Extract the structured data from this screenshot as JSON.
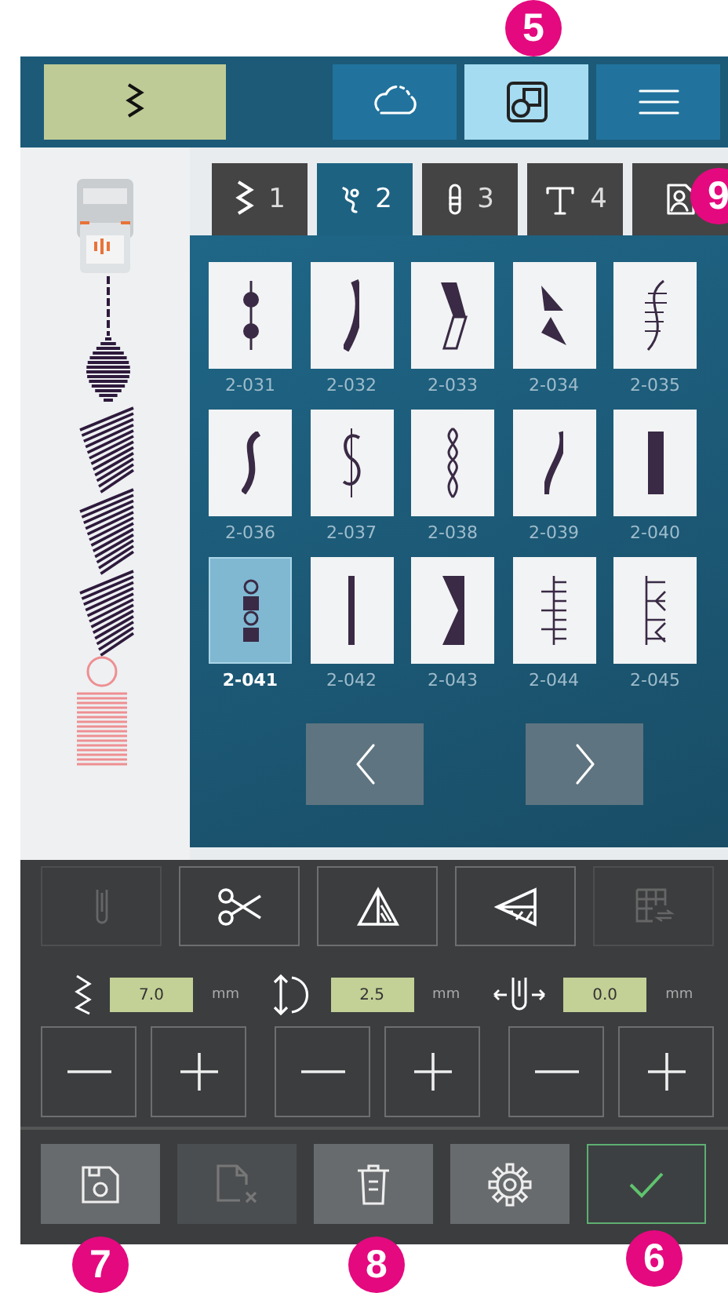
{
  "top_bar": {
    "stitch_button": {
      "kind": "zigzag"
    },
    "buttons": [
      {
        "kind": "cloud",
        "selected": false
      },
      {
        "kind": "patterns",
        "selected": true
      },
      {
        "kind": "menu",
        "selected": false
      }
    ]
  },
  "category_tabs": [
    {
      "label": "1",
      "kind": "zigzag",
      "selected": false
    },
    {
      "label": "2",
      "kind": "decorative",
      "selected": true
    },
    {
      "label": "3",
      "kind": "buttonhole",
      "selected": false
    },
    {
      "label": "4",
      "kind": "text",
      "selected": false
    },
    {
      "kind": "image",
      "selected": false
    }
  ],
  "stitches": [
    {
      "code": "2-031",
      "selected": false
    },
    {
      "code": "2-032",
      "selected": false
    },
    {
      "code": "2-033",
      "selected": false
    },
    {
      "code": "2-034",
      "selected": false
    },
    {
      "code": "2-035",
      "selected": false
    },
    {
      "code": "2-036",
      "selected": false
    },
    {
      "code": "2-037",
      "selected": false
    },
    {
      "code": "2-038",
      "selected": false
    },
    {
      "code": "2-039",
      "selected": false
    },
    {
      "code": "2-040",
      "selected": false
    },
    {
      "code": "2-041",
      "selected": true
    },
    {
      "code": "2-042",
      "selected": false
    },
    {
      "code": "2-043",
      "selected": false
    },
    {
      "code": "2-044",
      "selected": false
    },
    {
      "code": "2-045",
      "selected": false
    }
  ],
  "tools": [
    {
      "kind": "needle",
      "disabled": true
    },
    {
      "kind": "cut",
      "disabled": false
    },
    {
      "kind": "mirror-side",
      "disabled": false
    },
    {
      "kind": "mirror-end",
      "disabled": false
    },
    {
      "kind": "grid",
      "disabled": true
    }
  ],
  "settings": [
    {
      "kind": "width",
      "value": "7.0",
      "unit": "mm"
    },
    {
      "kind": "length",
      "value": "2.5",
      "unit": "mm"
    },
    {
      "kind": "position",
      "value": "0.0",
      "unit": "mm"
    }
  ],
  "actions": [
    {
      "kind": "save",
      "disabled": false
    },
    {
      "kind": "delete-file",
      "disabled": true
    },
    {
      "kind": "trash",
      "disabled": false
    },
    {
      "kind": "settings",
      "disabled": false
    },
    {
      "kind": "confirm",
      "disabled": false
    }
  ],
  "callouts": [
    {
      "number": "5"
    },
    {
      "number": "9"
    },
    {
      "number": "7"
    },
    {
      "number": "8"
    },
    {
      "number": "6"
    }
  ]
}
